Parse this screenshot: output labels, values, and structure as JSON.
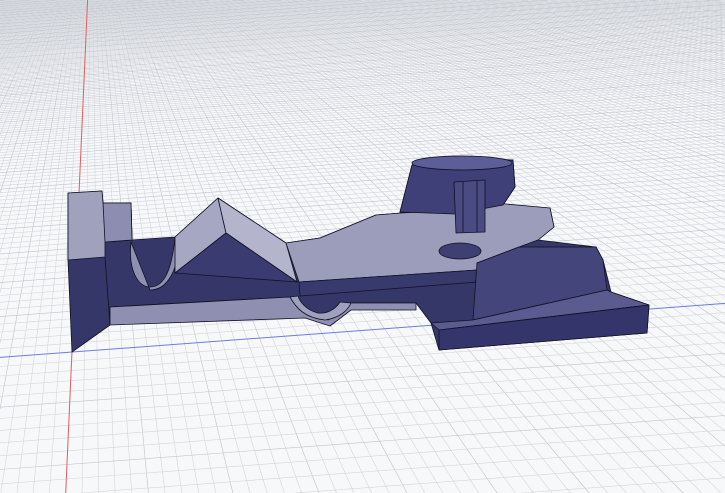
{
  "viewport": {
    "background": "#f7f8fa",
    "grid_color": "#d3d6dc",
    "grid_major_color": "#bfc3ca",
    "x_axis_color": "#6f7fe0",
    "y_axis_color": "#e06060"
  },
  "model": {
    "dark_color": "#363769",
    "mid_color": "#6e70a0",
    "light_color": "#a3a4c0",
    "edge_color": "#111122"
  }
}
